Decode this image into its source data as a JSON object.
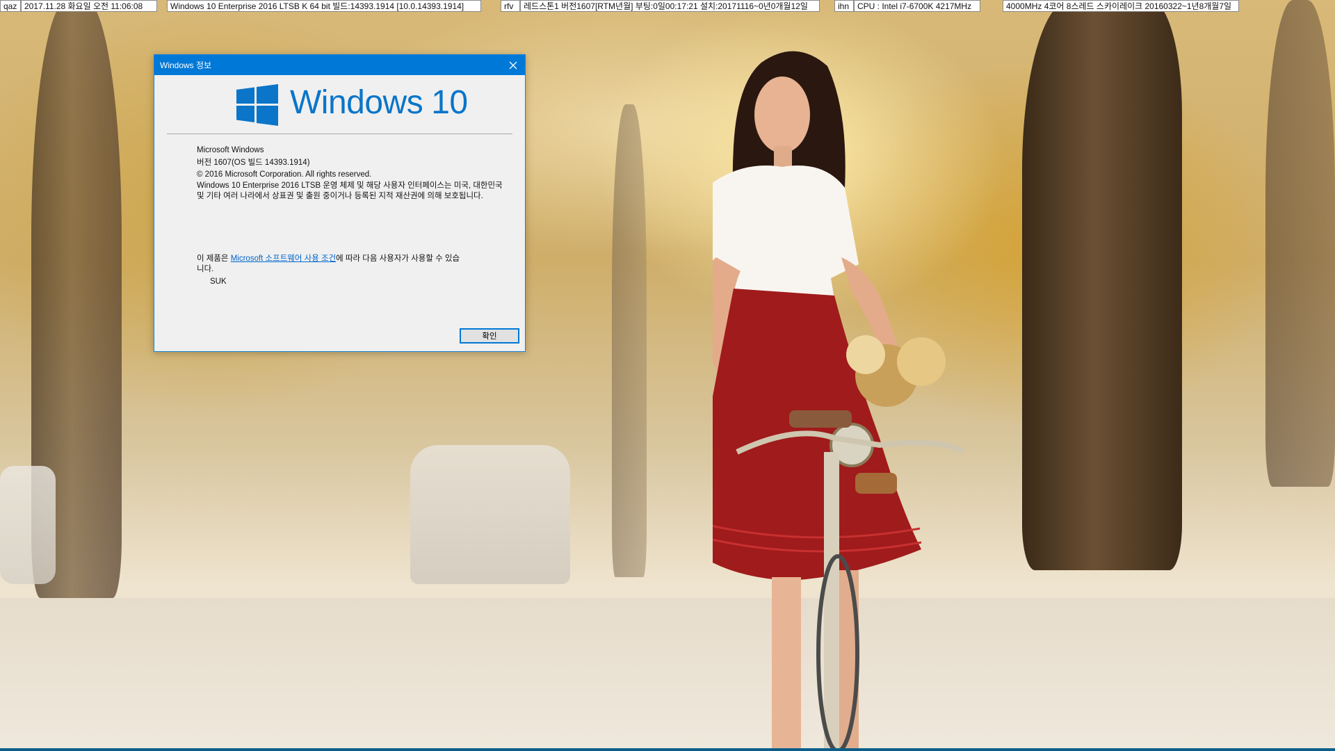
{
  "info_bar": [
    {
      "label": "qaz",
      "value": "2017.11.28 화요일  오전 11:06:08"
    },
    {
      "label": "",
      "value": "Windows 10 Enterprise 2016 LTSB K 64 bit 빌드:14393.1914 [10.0.14393.1914]"
    },
    {
      "label": "rfv",
      "value": "레드스톤1 버전1607[RTM년월] 부팅:0일00:17:21 설치:20171116~0년0개월12일"
    },
    {
      "label": "ihn",
      "value": "CPU : Intel i7-6700K 4217MHz"
    },
    {
      "label": "",
      "value": "4000MHz 4코어 8스레드 스카이레이크 20160322~1년8개월7일"
    }
  ],
  "dialog": {
    "title": "Windows 정보",
    "logo_word": "Windows",
    "logo_number": "10",
    "product": "Microsoft Windows",
    "version": "버전 1607(OS 빌드 14393.1914)",
    "copyright": "© 2016 Microsoft Corporation. All rights reserved.",
    "description": "Windows 10 Enterprise 2016 LTSB 운영 체제 및 해당 사용자 인터페이스는 미국, 대한민국 및 기타 여러 나라에서 상표권 및 출원 중이거나 등록된 지적 재산권에 의해 보호됩니다.",
    "license_prefix": "이 제품은 ",
    "license_link": "Microsoft 소프트웨어 사용 조건",
    "license_suffix": "에 따라 다음 사용자가 사용할 수 있습니다.",
    "licensed_user": "SUK",
    "ok_label": "확인",
    "accent_color": "#0078d7"
  },
  "icons": {
    "close": "close-icon",
    "logo": "windows-logo-icon"
  }
}
